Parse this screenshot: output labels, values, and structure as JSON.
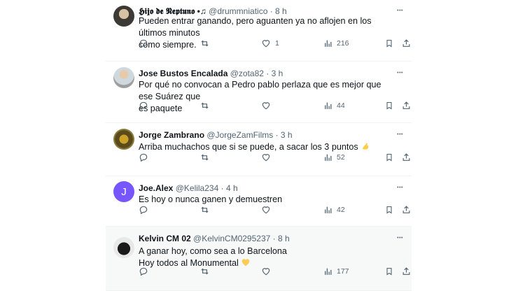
{
  "tweets": [
    {
      "name": "𝕳𝖎𝖏𝖔 𝖉𝖊 𝕹𝖊𝖕𝖙𝖚𝖓𝖔 •♫",
      "handle": "@drummniatico",
      "time": "8 h",
      "text": "Pueden entrar ganando, pero aguanten ya no aflojen en los últimos minutos\ncomo siempre.",
      "replies": "",
      "retweets": "",
      "likes": "1",
      "views": "216",
      "avatar_icon": "avatar-photo"
    },
    {
      "name": "Jose Bustos Encalada",
      "handle": "@zota82",
      "time": "3 h",
      "text": "Por qué no convocan a Pedro pablo perlaza que es mejor que ese Suárez que\nes paquete",
      "replies": "",
      "retweets": "",
      "likes": "",
      "views": "44",
      "avatar_icon": "avatar-photo"
    },
    {
      "name": "Jorge Zambrano",
      "handle": "@JorgeZamFilms",
      "time": "3 h",
      "text": "Arriba muchachos que si se puede, a sacar los 3 puntos",
      "emoji": "flexed-biceps-emoji",
      "replies": "",
      "retweets": "",
      "likes": "",
      "views": "52",
      "avatar_icon": "avatar-photo"
    },
    {
      "name": "Joe.Alex",
      "handle": "@Kelila234",
      "time": "4 h",
      "text": "Es hoy o nunca ganen y demuestren",
      "replies": "",
      "retweets": "",
      "likes": "",
      "views": "42",
      "avatar_letter": "J",
      "avatar_color": "#7856ff"
    },
    {
      "name": "Kelvin CM 02",
      "handle": "@KelvinCM0295237",
      "time": "8 h",
      "text": "A ganar hoy, como sea a lo Barcelona\nHoy todos al Monumental",
      "emoji": "yellow-heart-emoji",
      "replies": "",
      "retweets": "",
      "likes": "",
      "views": "177",
      "avatar_icon": "avatar-photo"
    }
  ],
  "colors": {
    "text": "#0f1419",
    "secondary": "#536471",
    "divider": "#eff3f4",
    "highlight": "#f7f9f9"
  }
}
